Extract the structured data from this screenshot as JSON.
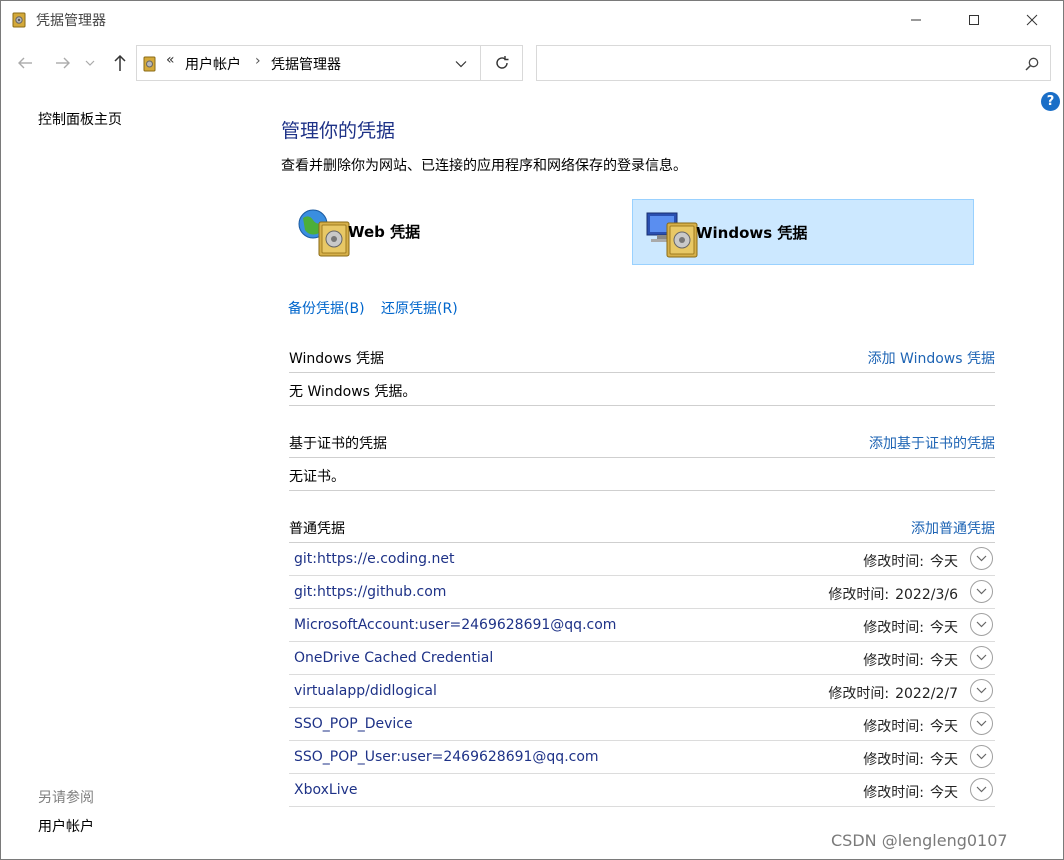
{
  "window": {
    "title": "凭据管理器"
  },
  "nav": {
    "address_chevron": "«",
    "address_segment_1": "用户帐户",
    "address_separator": "›",
    "address_segment_2": "凭据管理器",
    "search_placeholder": ""
  },
  "help": {
    "label": "?"
  },
  "sidebar": {
    "home": "控制面板主页",
    "see_also": "另请参阅",
    "user_accounts": "用户帐户"
  },
  "main": {
    "title": "管理你的凭据",
    "description": "查看并删除你为网站、已连接的应用程序和网络保存的登录信息。",
    "tiles": [
      {
        "label": "Web 凭据",
        "selected": false
      },
      {
        "label": "Windows 凭据",
        "selected": true
      }
    ],
    "backup_link": "备份凭据(B)",
    "restore_link": "还原凭据(R)",
    "windows_section": {
      "title": "Windows 凭据",
      "add": "添加 Windows 凭据",
      "empty": "无 Windows 凭据。"
    },
    "cert_section": {
      "title": "基于证书的凭据",
      "add": "添加基于证书的凭据",
      "empty": "无证书。"
    },
    "generic_section": {
      "title": "普通凭据",
      "add": "添加普通凭据",
      "modified_label": "修改时间:",
      "items": [
        {
          "name": "git:https://e.coding.net",
          "date": "今天"
        },
        {
          "name": "git:https://github.com",
          "date": "2022/3/6"
        },
        {
          "name": "MicrosoftAccount:user=2469628691@qq.com",
          "date": "今天"
        },
        {
          "name": "OneDrive Cached Credential",
          "date": "今天"
        },
        {
          "name": "virtualapp/didlogical",
          "date": "2022/2/7"
        },
        {
          "name": "SSO_POP_Device",
          "date": "今天"
        },
        {
          "name": "SSO_POP_User:user=2469628691@qq.com",
          "date": "今天"
        },
        {
          "name": "XboxLive",
          "date": "今天"
        }
      ]
    }
  },
  "watermark": "CSDN @lengleng0107",
  "colors": {
    "accent": "#0066cc",
    "title": "#1e3287",
    "selected_tile": "#cce8ff"
  }
}
